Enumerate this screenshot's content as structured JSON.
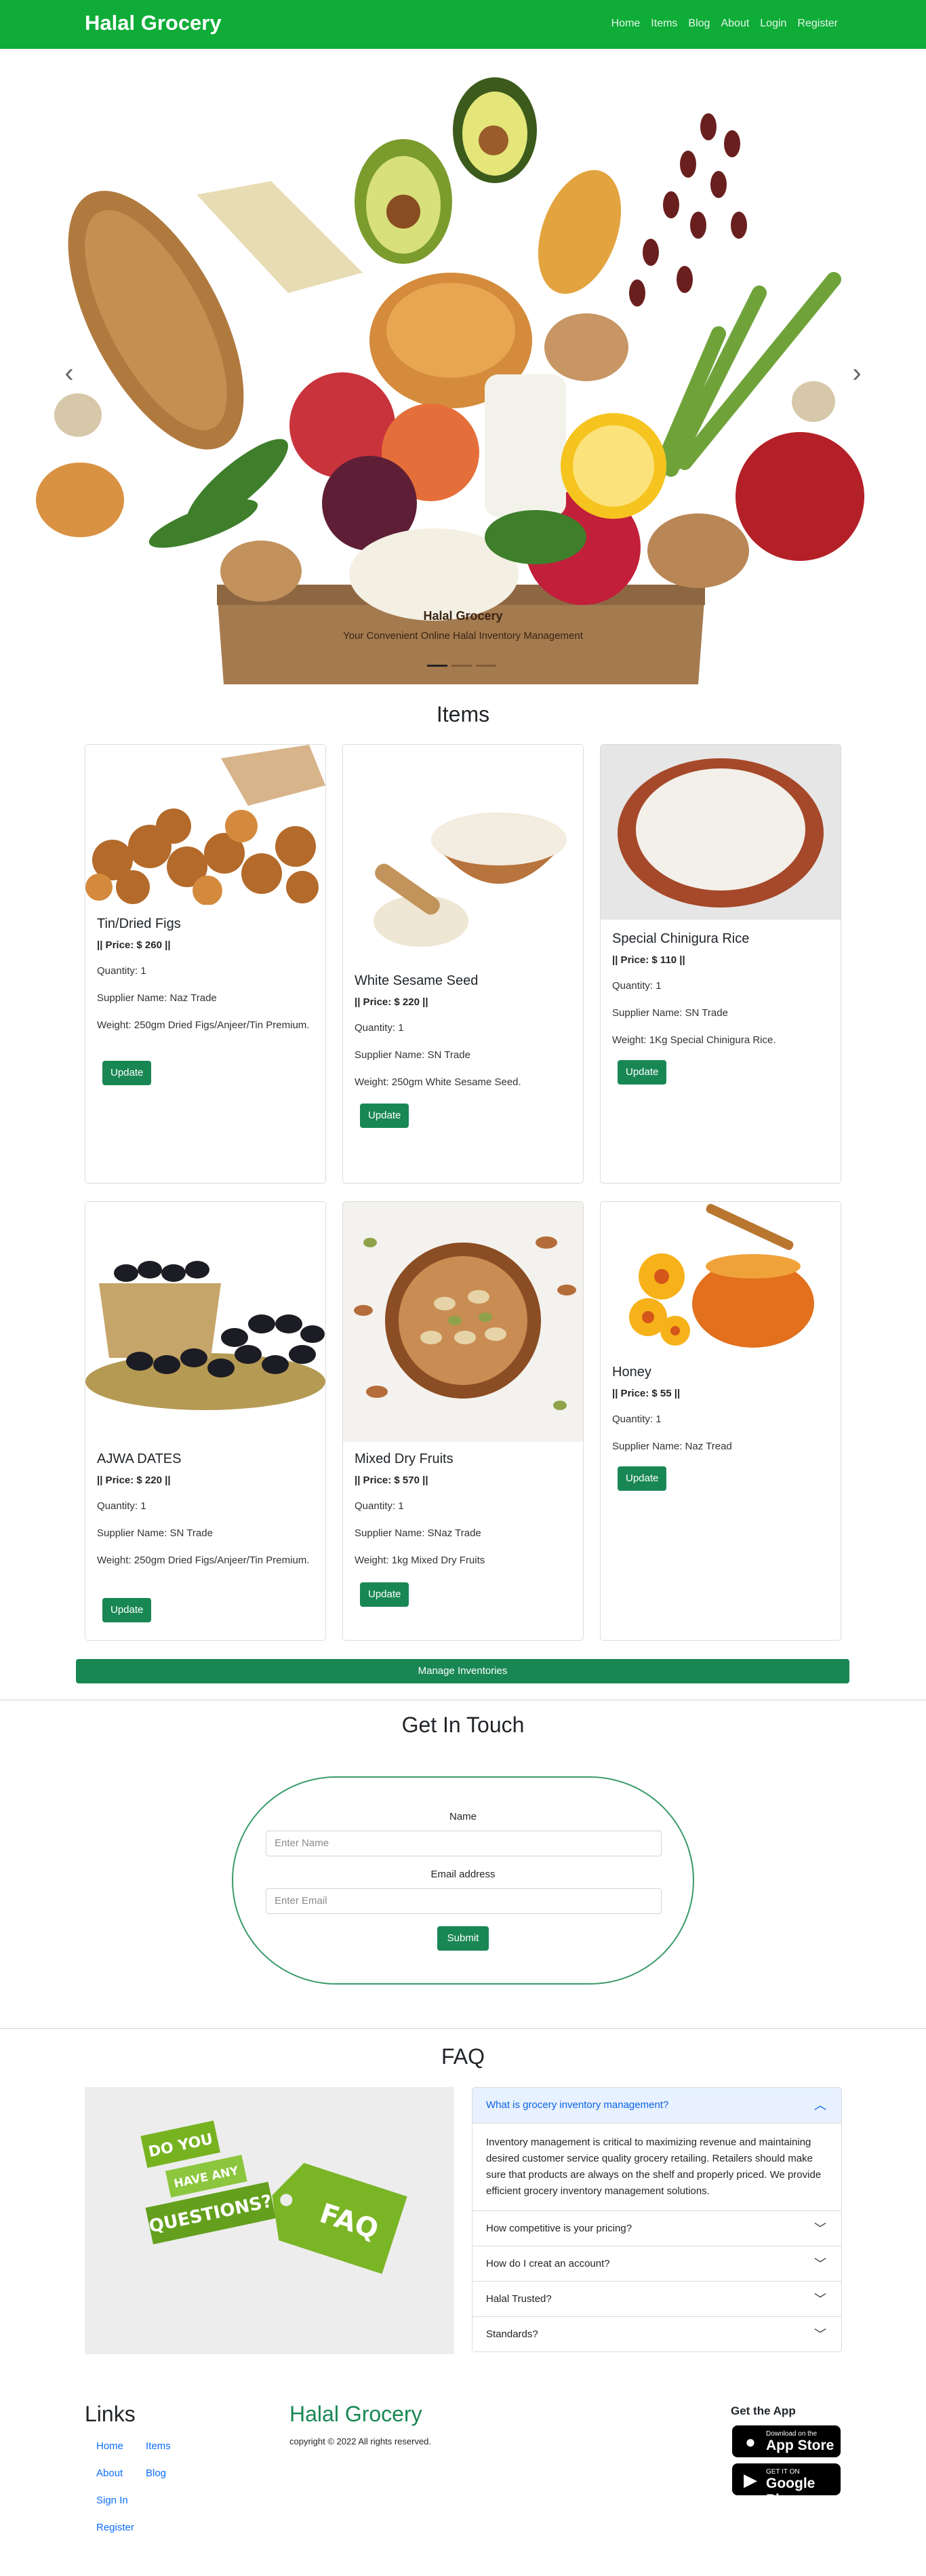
{
  "navbar": {
    "brand": "Halal Grocery",
    "links": [
      "Home",
      "Items",
      "Blog",
      "About",
      "Login",
      "Register"
    ]
  },
  "hero": {
    "caption_title": "Halal Grocery",
    "caption_subtitle": "Your Convenient Online Halal Inventory Management",
    "prev_icon": "chevron-left-icon",
    "next_icon": "chevron-right-icon",
    "slides_count": 3,
    "active_slide": 1
  },
  "items": {
    "title": "Items",
    "cards": [
      {
        "name": "Tin/Dried Figs",
        "price": "|| Price: $ 260 ||",
        "quantity": "Quantity: 1",
        "supplier": "Supplier Name: Naz Trade",
        "weight": "Weight: 250gm Dried Figs/Anjeer/Tin Premium.",
        "button": "Update"
      },
      {
        "name": "White Sesame Seed",
        "price": "|| Price: $ 220 ||",
        "quantity": "Quantity: 1",
        "supplier": "Supplier Name: SN Trade",
        "weight": "Weight: 250gm White Sesame Seed.",
        "button": "Update"
      },
      {
        "name": "Special Chinigura Rice",
        "price": "|| Price: $ 110 ||",
        "quantity": "Quantity: 1",
        "supplier": "Supplier Name: SN Trade",
        "weight": "Weight: 1Kg Special Chinigura Rice.",
        "button": "Update"
      },
      {
        "name": "AJWA DATES",
        "price": "|| Price: $ 220 ||",
        "quantity": "Quantity: 1",
        "supplier": "Supplier Name: SN Trade",
        "weight": "Weight: 250gm Dried Figs/Anjeer/Tin Premium.",
        "button": "Update"
      },
      {
        "name": "Mixed Dry Fruits",
        "price": "|| Price: $ 570 ||",
        "quantity": "Quantity: 1",
        "supplier": "Supplier Name: SNaz Trade",
        "weight": "Weight: 1kg Mixed Dry Fruits",
        "button": "Update"
      },
      {
        "name": "Honey",
        "price": "|| Price: $ 55 ||",
        "quantity": "Quantity: 1",
        "supplier": "Supplier Name: Naz Tread",
        "weight": "",
        "button": "Update"
      }
    ],
    "manage_button": "Manage Inventories"
  },
  "contact": {
    "title": "Get In Touch",
    "name_label": "Name",
    "name_placeholder": "Enter Name",
    "email_label": "Email address",
    "email_placeholder": "Enter Email",
    "submit_label": "Submit"
  },
  "faq": {
    "title": "FAQ",
    "image_text": {
      "line1": "DO YOU",
      "line2": "HAVE ANY",
      "line3": "QUESTIONS?",
      "tag": "FAQ"
    },
    "items": [
      {
        "question": "What is grocery inventory management?",
        "answer": "Inventory management is critical to maximizing revenue and maintaining desired customer service quality grocery retailing. Retailers should make sure that products are always on the shelf and properly priced. We provide efficient grocery inventory management solutions.",
        "expanded": true
      },
      {
        "question": "How competitive is your pricing?",
        "expanded": false
      },
      {
        "question": "How do I creat an account?",
        "expanded": false
      },
      {
        "question": "Halal Trusted?",
        "expanded": false
      },
      {
        "question": "Standards?",
        "expanded": false
      }
    ]
  },
  "footer": {
    "links_title": "Links",
    "links": [
      "Home",
      "Items",
      "About",
      "Blog",
      "Sign In",
      "Register"
    ],
    "brand": "Halal Grocery",
    "copyright": "copyright © 2022 All rights reserved.",
    "get_app": "Get the App",
    "app_store": {
      "small": "Download on the",
      "big": "App Store"
    },
    "google_play": {
      "small": "GET IT ON",
      "big": "Google Play"
    }
  },
  "colors": {
    "navbar": "#0fac38",
    "button": "#198754",
    "link": "#0d6efd",
    "accordion_active_bg": "#e7f1ff"
  }
}
